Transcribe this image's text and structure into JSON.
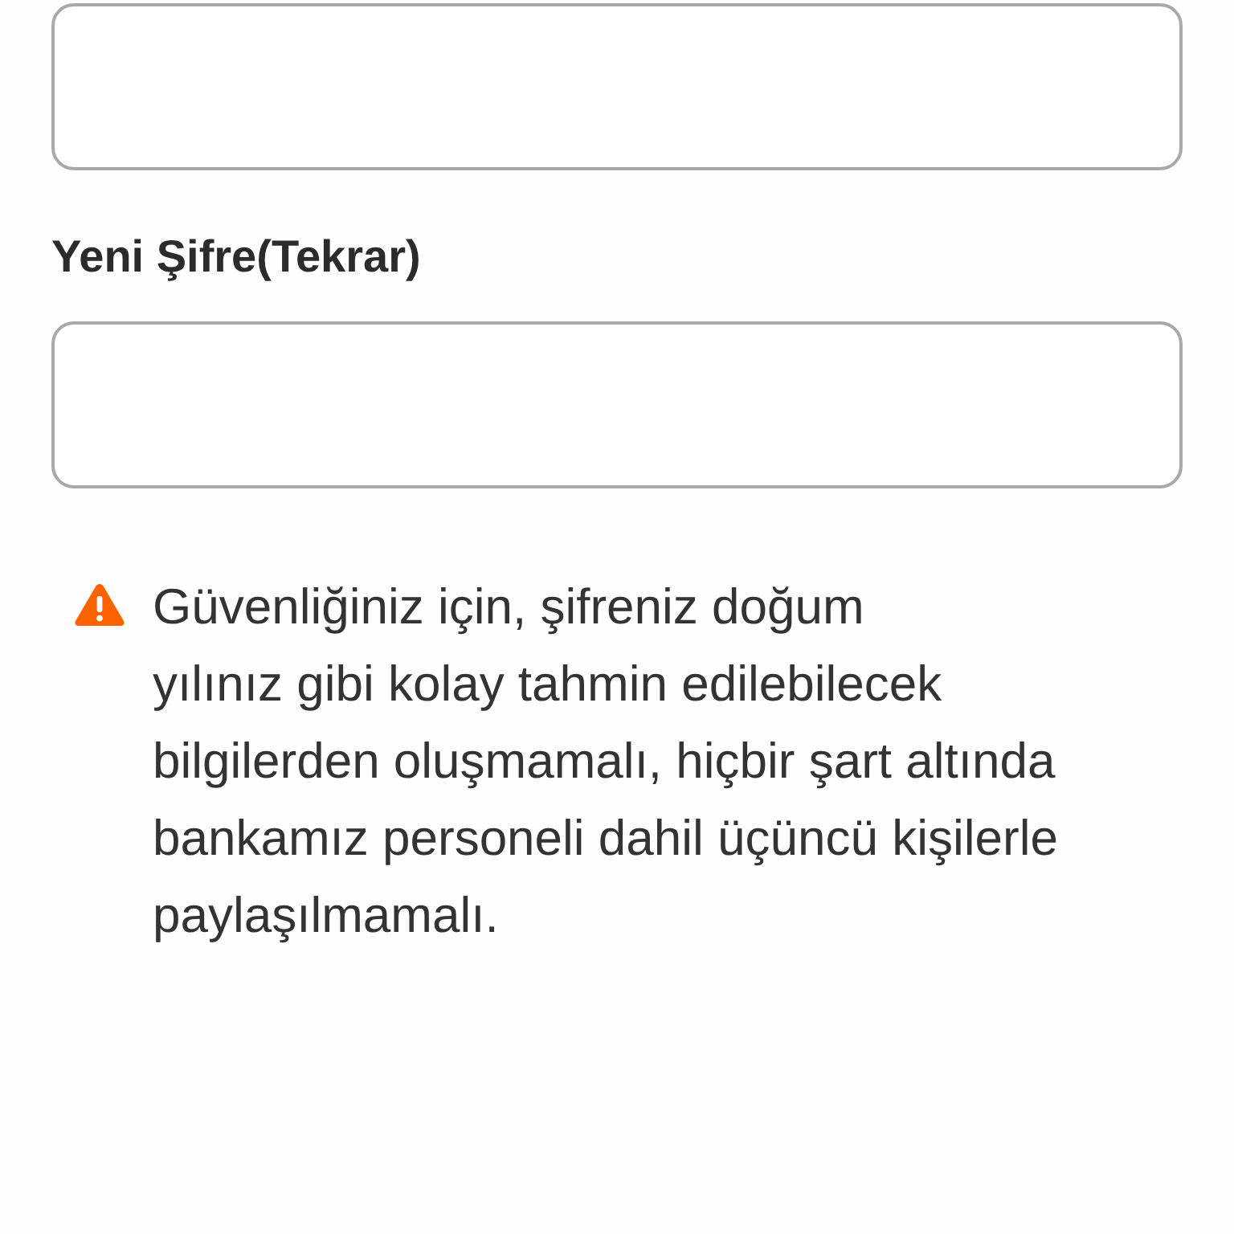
{
  "form": [
    {
      "kind": "field"
    },
    {
      "kind": "label",
      "text": "Yeni Şifre(Tekrar)"
    },
    {
      "kind": "field"
    }
  ],
  "warning": {
    "kind": "alert",
    "text": "Güvenliğiniz için, şifreniz doğum\nyılınız gibi kolay tahmin edilebilecek\nbilgilerden oluşmamalı, hiçbir şart altında\nbankamız personeli dahil üçüncü kişilerle\npaylaşılmamalı."
  }
}
